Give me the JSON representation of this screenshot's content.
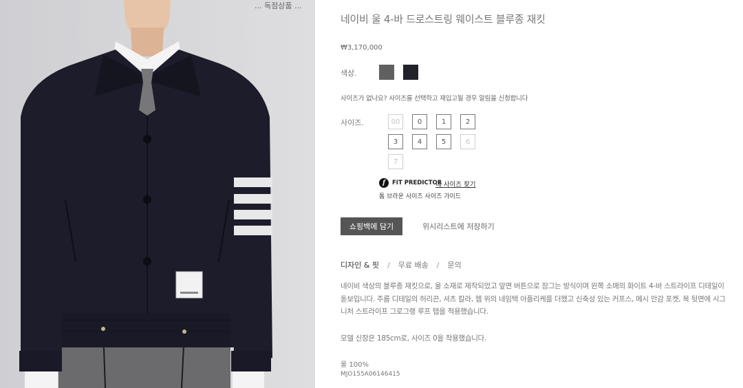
{
  "image": {
    "badge": "... 독점상품 ..."
  },
  "product": {
    "title": "네이비 울 4-바 드로스트링 웨이스트 블루종 재킷",
    "price": "₩3,170,000",
    "color_label": "색상.",
    "colors": [
      "#606060",
      "#22222a"
    ],
    "size_notice": "사이즈가 없나요? 사이즈를 선택하고 재입고될 경우 알림을 신청합니다",
    "size_label": "사이즈.",
    "sizes": [
      {
        "label": "00",
        "available": false
      },
      {
        "label": "0",
        "available": true
      },
      {
        "label": "1",
        "available": true
      },
      {
        "label": "2",
        "available": true
      },
      {
        "label": "3",
        "available": true
      },
      {
        "label": "4",
        "available": true
      },
      {
        "label": "5",
        "available": true
      },
      {
        "label": "6",
        "available": false
      },
      {
        "label": "7",
        "available": false
      }
    ],
    "fit_predictor": {
      "icon": "f",
      "label": "FIT PREDICTOR",
      "link": "내 사이즈 찾기"
    },
    "size_guide": "톰 브라운 사이즈 사이즈 가이드",
    "add_to_bag": "쇼핑백에 담기",
    "wishlist": "위시리스트에 저장하기"
  },
  "tabs": [
    "디자인 & 핏",
    "무료 배송",
    "문의"
  ],
  "tab_separator": "/",
  "description": "네이비 색상의 블루종 재킷으로, 울 소재로 제작되었고 앞면 버튼으로 잠그는 방식이며 왼쪽 소매의 화이트 4-바 스트라이프 디테일이 돋보입니다. 주름 디테일의 허리끈, 셔츠 칼라, 헴 위의 네임택 아플리케를 더했고 신축성 있는 커프스, 메시 안감 포켓, 목 뒷면에 시그니처 스트라이프 그로그랭 루프 탭을 적용했습니다.",
  "model_info": "모델 신장은 185cm로, 사이즈 0을 착용했습니다.",
  "material": "울 100%",
  "sku": "MJO155A06146415"
}
